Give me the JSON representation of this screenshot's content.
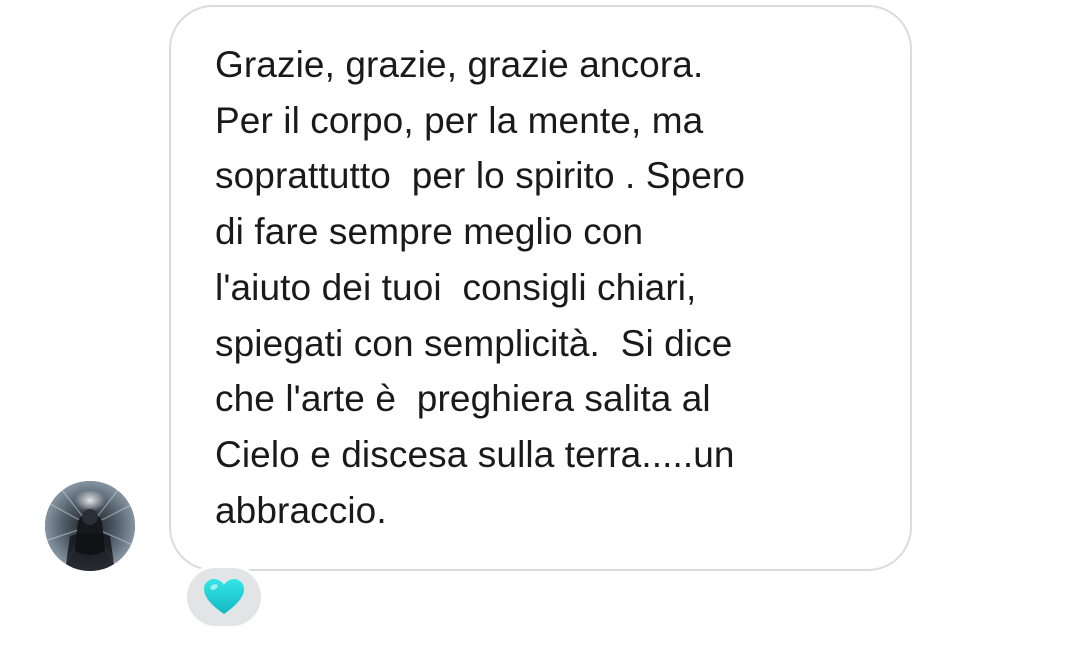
{
  "message": {
    "lines": [
      "Grazie, grazie, grazie ancora.",
      "Per il corpo, per la mente, ma",
      "soprattutto  per lo spirito . Spero",
      "di fare sempre meglio con",
      "l'aiuto dei tuoi  consigli chiari,",
      "spiegati con semplicità.  Si dice",
      "che l'arte è  preghiera salita al",
      "Cielo e discesa sulla terra.....un",
      "abbraccio."
    ]
  },
  "sender": {
    "avatar_icon": "profile-avatar-icon"
  },
  "reaction": {
    "icon": "heart-icon",
    "color": "#1fd1d6"
  }
}
